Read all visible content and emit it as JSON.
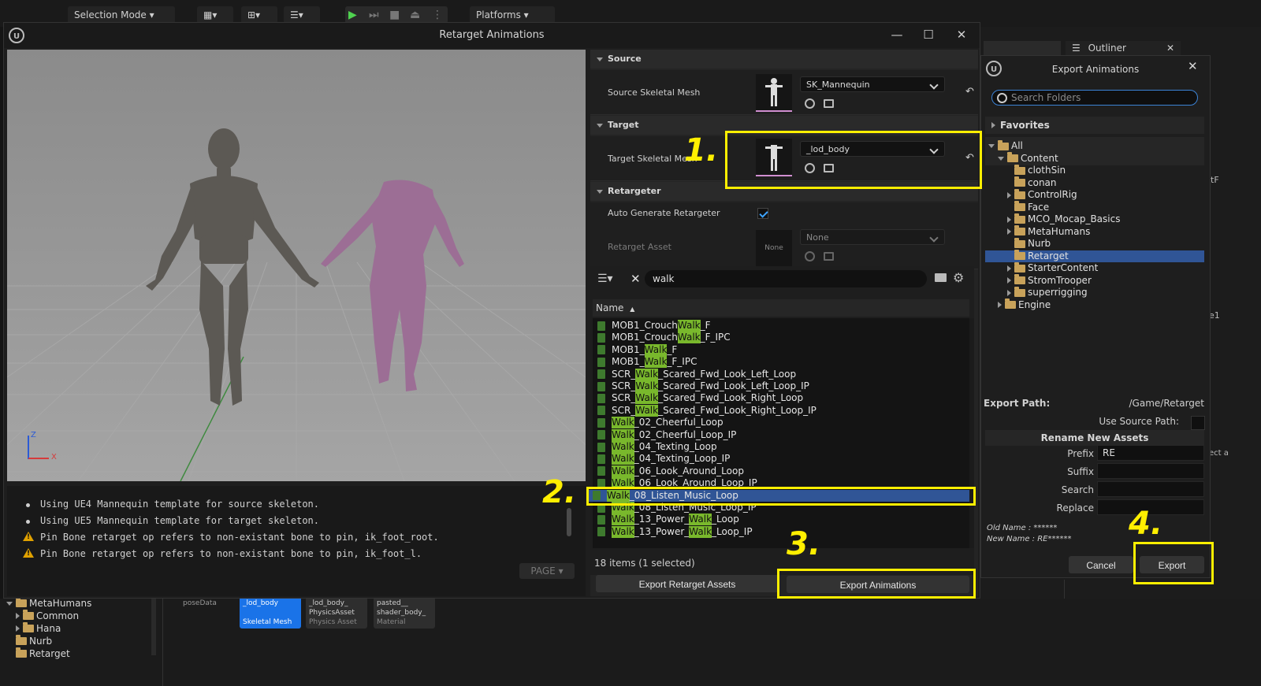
{
  "editor": {
    "selection_mode": "Selection Mode",
    "platforms": "Platforms",
    "outliner_tab": "Outliner",
    "side_labels": [
      "tF",
      "e1",
      "ect a"
    ],
    "content_tree": [
      "MetaHumans",
      "Common",
      "Hana",
      "Nurb",
      "Retarget"
    ],
    "bottom_assets": [
      {
        "name": "poseData",
        "type": ""
      },
      {
        "name": "_lod_body",
        "type": "Skeletal Mesh"
      },
      {
        "name": "_lod_body_ PhysicsAsset",
        "type": "Physics Asset"
      },
      {
        "name": "pasted__ shader_body_",
        "type": "Material"
      }
    ]
  },
  "window": {
    "title": "Retarget Animations",
    "minimize": "—",
    "maximize": "☐",
    "close": "✕"
  },
  "viewport": {
    "axis_z": "Z",
    "axis_x": "X"
  },
  "log": {
    "lines": [
      "Using UE4 Mannequin template for source skeleton.",
      "Using UE5 Mannequin template for target skeleton.",
      "Pin Bone retarget op refers to non-existant bone to pin, ik_foot_root.",
      "Pin Bone retarget op refers to non-existant bone to pin, ik_foot_l."
    ],
    "page_button": "PAGE"
  },
  "details": {
    "source": {
      "header": "Source",
      "label": "Source Skeletal Mesh",
      "value": "SK_Mannequin"
    },
    "target": {
      "header": "Target",
      "label": "Target Skeletal Mesh",
      "value": "_lod_body"
    },
    "retargeter": {
      "header": "Retargeter",
      "auto_label": "Auto Generate Retargeter",
      "auto_checked": true,
      "asset_label": "Retarget Asset",
      "asset_value": "None",
      "asset_thumb": "None"
    }
  },
  "browser": {
    "search_value": "walk",
    "column_name": "Name",
    "count": "18 items (1 selected)",
    "items": [
      {
        "pre": "MOB1_Crouch",
        "hl": "Walk",
        "post": "_F",
        "hl2": "",
        "post2": ""
      },
      {
        "pre": "MOB1_Crouch",
        "hl": "Walk",
        "post": "_F_IPC",
        "hl2": "",
        "post2": ""
      },
      {
        "pre": "MOB1_",
        "hl": "Walk",
        "post": "_F",
        "hl2": "",
        "post2": ""
      },
      {
        "pre": "MOB1_",
        "hl": "Walk",
        "post": "_F_IPC",
        "hl2": "",
        "post2": ""
      },
      {
        "pre": "SCR_",
        "hl": "Walk",
        "post": "_Scared_Fwd_Look_Left_Loop",
        "hl2": "",
        "post2": ""
      },
      {
        "pre": "SCR_",
        "hl": "Walk",
        "post": "_Scared_Fwd_Look_Left_Loop_IP",
        "hl2": "",
        "post2": ""
      },
      {
        "pre": "SCR_",
        "hl": "Walk",
        "post": "_Scared_Fwd_Look_Right_Loop",
        "hl2": "",
        "post2": ""
      },
      {
        "pre": "SCR_",
        "hl": "Walk",
        "post": "_Scared_Fwd_Look_Right_Loop_IP",
        "hl2": "",
        "post2": ""
      },
      {
        "pre": "",
        "hl": "Walk",
        "post": "_02_Cheerful_Loop",
        "hl2": "",
        "post2": ""
      },
      {
        "pre": "",
        "hl": "Walk",
        "post": "_02_Cheerful_Loop_IP",
        "hl2": "",
        "post2": ""
      },
      {
        "pre": "",
        "hl": "Walk",
        "post": "_04_Texting_Loop",
        "hl2": "",
        "post2": ""
      },
      {
        "pre": "",
        "hl": "Walk",
        "post": "_04_Texting_Loop_IP",
        "hl2": "",
        "post2": ""
      },
      {
        "pre": "",
        "hl": "Walk",
        "post": "_06_Look_Around_Loop",
        "hl2": "",
        "post2": ""
      },
      {
        "pre": "",
        "hl": "Walk",
        "post": "_06_Look_Around_Loop_IP",
        "hl2": "",
        "post2": ""
      },
      {
        "pre": "",
        "hl": "Walk",
        "post": "_08_Listen_Music_Loop",
        "hl2": "",
        "post2": ""
      },
      {
        "pre": "",
        "hl": "Walk",
        "post": "_08_Listen_Music_Loop_IP",
        "hl2": "",
        "post2": ""
      },
      {
        "pre": "",
        "hl": "Walk",
        "post": "_13_Power_",
        "hl2": "Walk",
        "post2": "_Loop"
      },
      {
        "pre": "",
        "hl": "Walk",
        "post": "_13_Power_",
        "hl2": "Walk",
        "post2": "_Loop_IP"
      }
    ],
    "selected_index": 14,
    "export_retarget_assets": "Export Retarget Assets",
    "export_animations": "Export Animations"
  },
  "export_dialog": {
    "title": "Export Animations",
    "close": "✕",
    "search_placeholder": "Search Folders",
    "favorites": "Favorites",
    "tree": [
      {
        "label": "All",
        "depth": 0,
        "expanded": true
      },
      {
        "label": "Content",
        "depth": 1,
        "expanded": true
      },
      {
        "label": "clothSin",
        "depth": 2,
        "expanded": false,
        "leaf": true
      },
      {
        "label": "conan",
        "depth": 2,
        "expanded": false,
        "leaf": true
      },
      {
        "label": "ControlRig",
        "depth": 2,
        "expanded": false,
        "leaf": false
      },
      {
        "label": "Face",
        "depth": 2,
        "expanded": false,
        "leaf": true
      },
      {
        "label": "MCO_Mocap_Basics",
        "depth": 2,
        "expanded": false,
        "leaf": false
      },
      {
        "label": "MetaHumans",
        "depth": 2,
        "expanded": false,
        "leaf": false
      },
      {
        "label": "Nurb",
        "depth": 2,
        "expanded": false,
        "leaf": true
      },
      {
        "label": "Retarget",
        "depth": 2,
        "expanded": false,
        "leaf": true,
        "selected": true
      },
      {
        "label": "StarterContent",
        "depth": 2,
        "expanded": false,
        "leaf": false
      },
      {
        "label": "StromTrooper",
        "depth": 2,
        "expanded": false,
        "leaf": false
      },
      {
        "label": "superrigging",
        "depth": 2,
        "expanded": false,
        "leaf": false
      },
      {
        "label": "Engine",
        "depth": 1,
        "expanded": false,
        "leaf": false
      }
    ],
    "export_path_label": "Export Path:",
    "export_path_value": "/Game/Retarget",
    "use_source_path_label": "Use Source Path:",
    "rename_header": "Rename New Assets",
    "prefix_label": "Prefix",
    "prefix_value": "RE",
    "suffix_label": "Suffix",
    "suffix_value": "",
    "search_label": "Search",
    "search_value": "",
    "replace_label": "Replace",
    "replace_value": "",
    "old_name": "Old Name : ******",
    "new_name": "New Name : RE******",
    "cancel": "Cancel",
    "export": "Export"
  },
  "annotations": {
    "step1": "1.",
    "step2": "2.",
    "step3": "3.",
    "step4": "4.",
    "color": "#ffef00"
  }
}
